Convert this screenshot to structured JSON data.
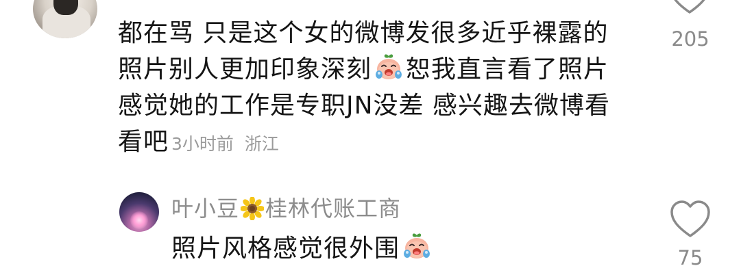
{
  "comments": [
    {
      "text_part1": "都在骂 只是这个女的微博发很多近乎裸露的照片别人更加印象深刻",
      "text_part2": "恕我直言看了照片感觉她的工作是专职JN没差 感兴趣去微博看看吧",
      "time": "3小时前",
      "location": "浙江",
      "like_count": "205"
    },
    {
      "username": "叶小豆",
      "username_suffix": "桂林代账工商",
      "text": "照片风格感觉很外围",
      "like_count": "75"
    }
  ],
  "icons": {
    "emoji": "laughing-crying-emoji-icon",
    "flower": "sunflower-icon",
    "like": "heart-outline-icon"
  },
  "colors": {
    "text": "#151515",
    "meta": "#9a9a9a",
    "username": "#8c8c8c"
  }
}
